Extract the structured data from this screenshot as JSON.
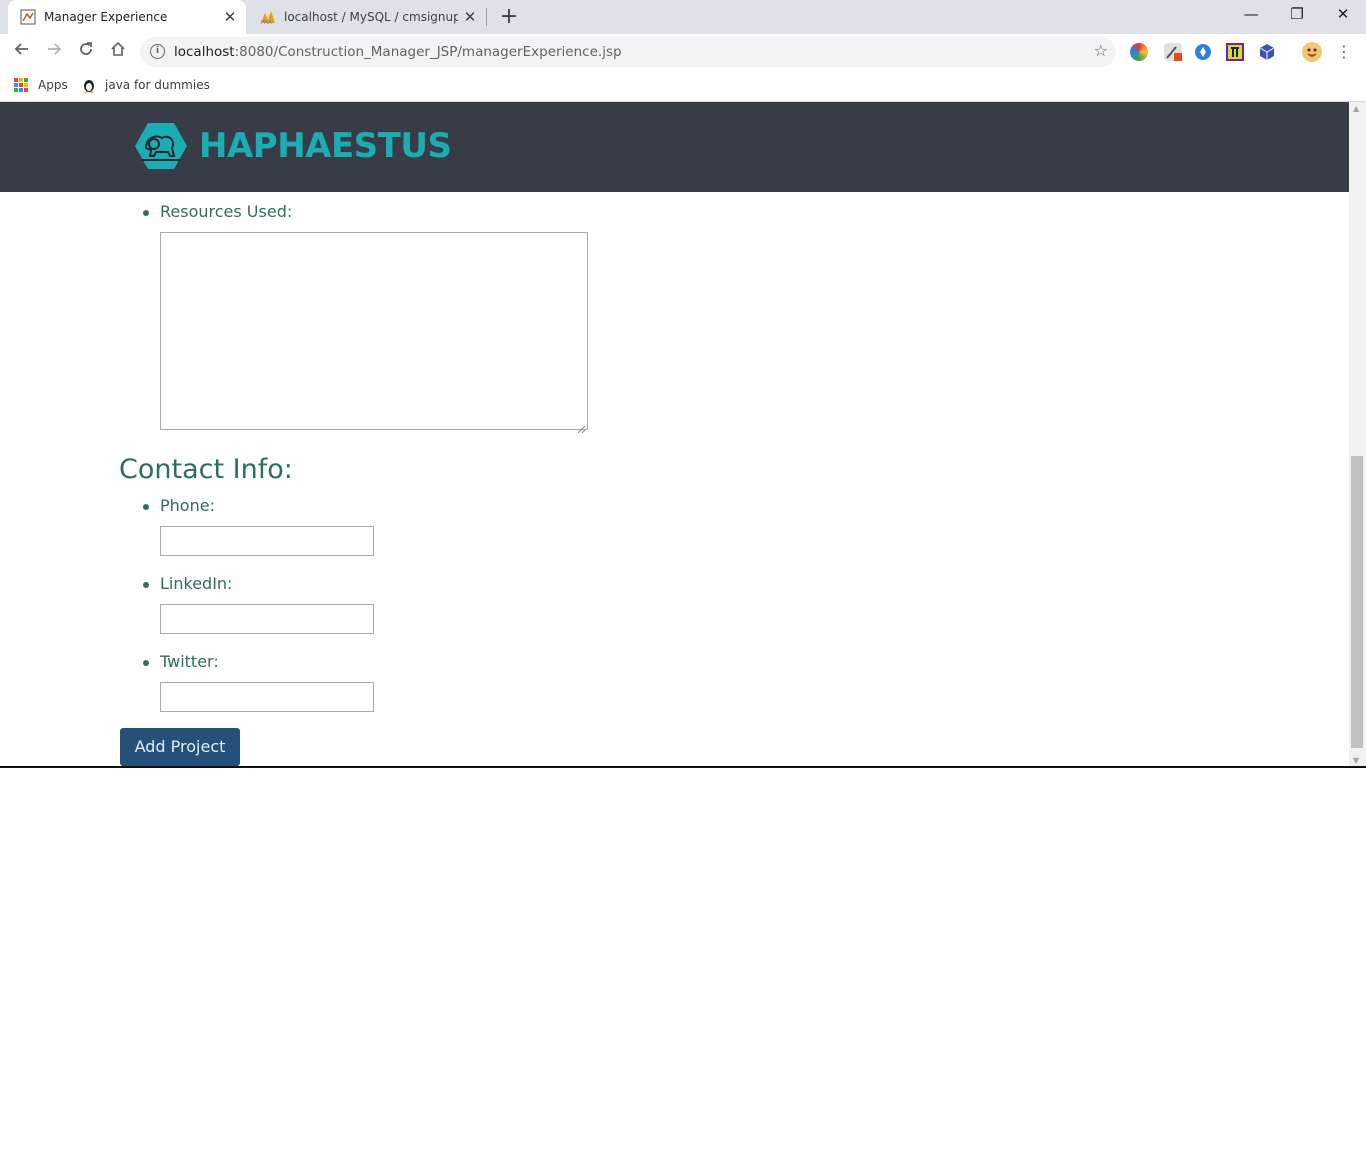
{
  "browser": {
    "tabs": [
      {
        "title": "Manager Experience",
        "active": true
      },
      {
        "title": "localhost / MySQL / cmsignup | p",
        "active": false
      }
    ],
    "new_tab": "+",
    "window_controls": {
      "minimize": "—",
      "maximize": "❐",
      "close": "✕"
    },
    "url_host": "localhost",
    "url_path": ":8080/Construction_Manager_JSP/managerExperience.jsp",
    "bookmarks": [
      {
        "label": "Apps",
        "icon": "apps-grid-icon"
      },
      {
        "label": "java for dummies",
        "icon": "java-bookmark-icon"
      }
    ]
  },
  "header": {
    "logo_text": "HAPHAESTUS",
    "logo_color": "#1aaeb4",
    "background": "#373c47"
  },
  "form": {
    "resources_label": "Resources Used:",
    "resources_value": "",
    "contact_title": "Contact Info:",
    "fields": [
      {
        "label": "Phone:",
        "value": ""
      },
      {
        "label": "LinkedIn:",
        "value": ""
      },
      {
        "label": "Twitter:",
        "value": ""
      }
    ],
    "submit_label": "Add Project",
    "accent": "#2e6f57",
    "button_color": "#24507a"
  }
}
